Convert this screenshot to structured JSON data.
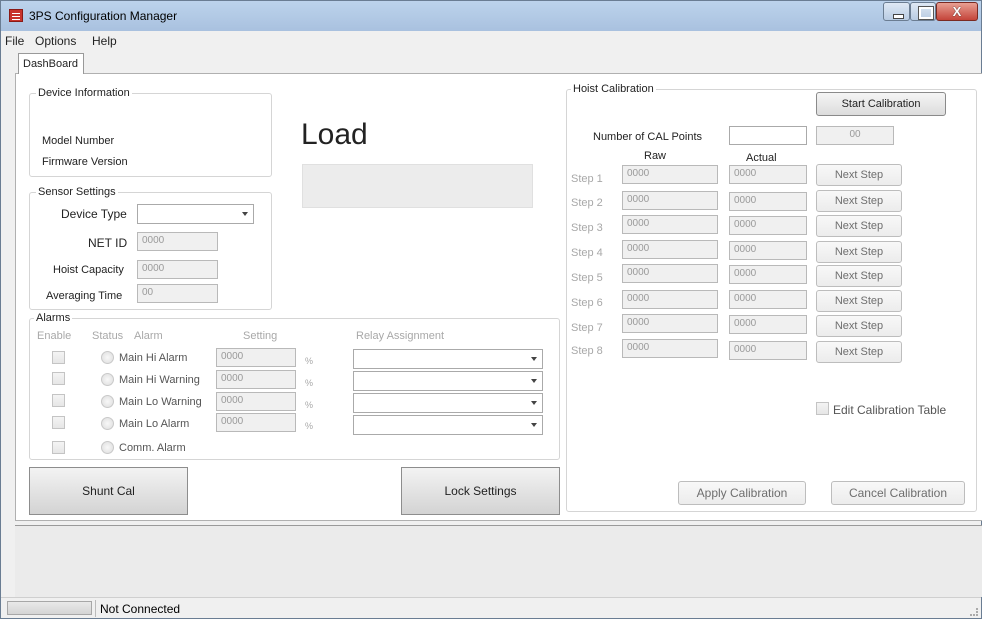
{
  "window": {
    "title": "3PS Configuration Manager",
    "close_glyph": "X"
  },
  "menu": {
    "file": "File",
    "options": "Options",
    "help": "Help"
  },
  "tabs": {
    "dashboard": "DashBoard"
  },
  "device_info": {
    "title": "Device Information",
    "model_label": "Model Number",
    "firmware_label": "Firmware Version"
  },
  "load": {
    "label": "Load"
  },
  "sensor": {
    "title": "Sensor Settings",
    "device_type_label": "Device Type",
    "net_id_label": "NET ID",
    "net_id_value": "0000",
    "hoist_capacity_label": "Hoist Capacity",
    "hoist_capacity_value": "0000",
    "averaging_label": "Averaging Time",
    "averaging_value": "00"
  },
  "alarms": {
    "title": "Alarms",
    "headers": {
      "enable": "Enable",
      "status": "Status",
      "alarm": "Alarm",
      "setting": "Setting",
      "relay": "Relay Assignment"
    },
    "rows": [
      {
        "name": "Main Hi Alarm",
        "value": "0000",
        "unit": "%"
      },
      {
        "name": "Main Hi Warning",
        "value": "0000",
        "unit": "%"
      },
      {
        "name": "Main Lo Warning",
        "value": "0000",
        "unit": "%"
      },
      {
        "name": "Main Lo Alarm",
        "value": "0000",
        "unit": "%"
      },
      {
        "name": "Comm. Alarm"
      }
    ]
  },
  "buttons": {
    "shunt_cal": "Shunt Cal",
    "lock_settings": "Lock Settings"
  },
  "hoist": {
    "title": "Hoist Calibration",
    "start": "Start Calibration",
    "num_points_label": "Number of CAL Points",
    "num_points_value": "00",
    "raw_header": "Raw",
    "actual_header": "Actual",
    "steps": [
      {
        "label": "Step 1",
        "raw": "0000",
        "actual": "0000",
        "button": "Next Step"
      },
      {
        "label": "Step 2",
        "raw": "0000",
        "actual": "0000",
        "button": "Next Step"
      },
      {
        "label": "Step 3",
        "raw": "0000",
        "actual": "0000",
        "button": "Next Step"
      },
      {
        "label": "Step 4",
        "raw": "0000",
        "actual": "0000",
        "button": "Next Step"
      },
      {
        "label": "Step 5",
        "raw": "0000",
        "actual": "0000",
        "button": "Next Step"
      },
      {
        "label": "Step 6",
        "raw": "0000",
        "actual": "0000",
        "button": "Next Step"
      },
      {
        "label": "Step 7",
        "raw": "0000",
        "actual": "0000",
        "button": "Next Step"
      },
      {
        "label": "Step 8",
        "raw": "0000",
        "actual": "0000",
        "button": "Next Step"
      }
    ],
    "edit_table": "Edit Calibration Table",
    "apply": "Apply Calibration",
    "cancel": "Cancel Calibration"
  },
  "status": {
    "connection": "Not Connected"
  }
}
